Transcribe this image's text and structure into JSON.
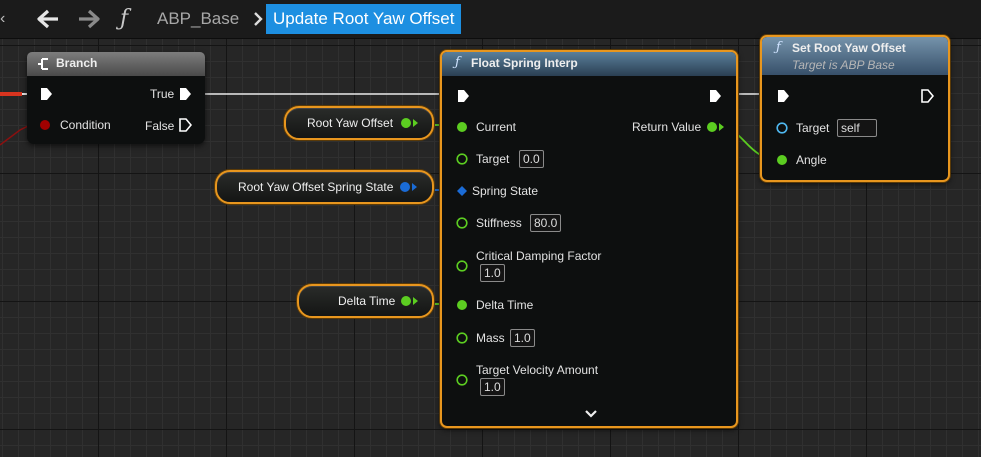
{
  "toolbar": {
    "breadcrumb_blueprint": "ABP_Base",
    "breadcrumb_function": "Update Root Yaw Offset"
  },
  "branch_node": {
    "title": "Branch",
    "condition_label": "Condition",
    "true_label": "True",
    "false_label": "False"
  },
  "spring_node": {
    "title": "Float Spring Interp",
    "current_label": "Current",
    "target_label": "Target",
    "target_value": "0.0",
    "spring_state_label": "Spring State",
    "stiffness_label": "Stiffness",
    "stiffness_value": "80.0",
    "damping_label": "Critical Damping Factor",
    "damping_value": "1.0",
    "delta_time_label": "Delta Time",
    "mass_label": "Mass",
    "mass_value": "1.0",
    "velocity_label": "Target Velocity Amount",
    "velocity_value": "1.0",
    "return_label": "Return Value"
  },
  "set_node": {
    "title": "Set Root Yaw Offset",
    "subtitle": "Target is ABP Base",
    "target_label": "Target",
    "target_value": "self",
    "angle_label": "Angle"
  },
  "variables": {
    "root_yaw_offset": "Root Yaw Offset",
    "spring_state": "Root Yaw Offset Spring State",
    "delta_time": "Delta Time"
  },
  "colors": {
    "float_pin": "#5ccd21",
    "struct_pin": "#1a6bd6",
    "object_pin": "#4fb8f0",
    "bool_pin": "#a00000",
    "selection": "#e8961e",
    "breadcrumb_highlight": "#1d8fe1"
  }
}
